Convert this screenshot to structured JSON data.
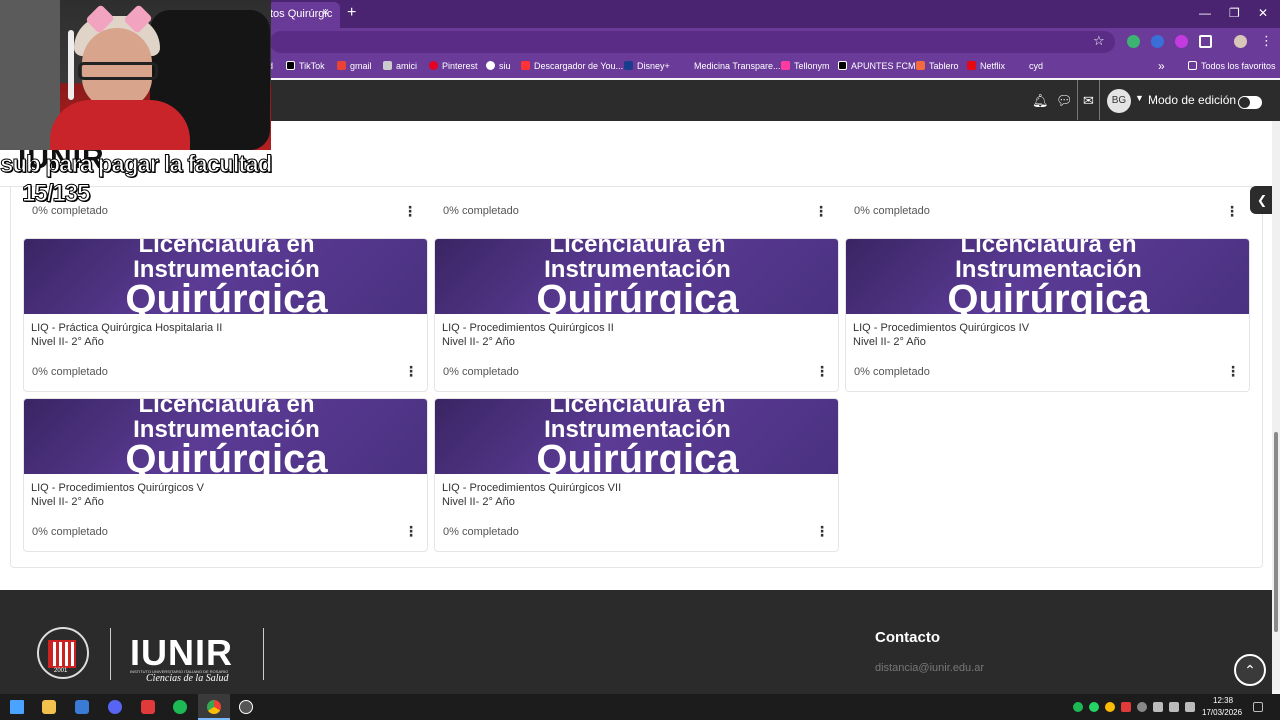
{
  "browser": {
    "tab_title": "tos Quirúrgic",
    "tab_close": "×",
    "new_tab": "+",
    "window_controls": [
      "—",
      "❐",
      "✕"
    ],
    "bookmarks": [
      {
        "label": "d",
        "icon": "bookmark-icon",
        "color": "#ffffff"
      },
      {
        "label": "TikTok",
        "icon": "tiktok-icon",
        "color": "#000000"
      },
      {
        "label": "gmail",
        "icon": "gmail-icon",
        "color": "#ea4335"
      },
      {
        "label": "amici",
        "icon": "amici-icon",
        "color": "#cccccc"
      },
      {
        "label": "Pinterest",
        "icon": "pinterest-icon",
        "color": "#e60023"
      },
      {
        "label": "siu",
        "icon": "siu-icon",
        "color": "#ffffff"
      },
      {
        "label": "Descargador de You...",
        "icon": "downloader-icon",
        "color": "#ff3333"
      },
      {
        "label": "Disney+",
        "icon": "disney-icon",
        "color": "#1a3c8c"
      },
      {
        "label": "Medicina Transpare...",
        "icon": "medicina-icon",
        "color": "#6b3b9a"
      },
      {
        "label": "Tellonym",
        "icon": "tellonym-icon",
        "color": "#ff3aa0"
      },
      {
        "label": "APUNTES FCM",
        "icon": "apuntes-icon",
        "color": "#000000"
      },
      {
        "label": "Tablero",
        "icon": "tablero-icon",
        "color": "#f26a3d"
      },
      {
        "label": "Netflix",
        "icon": "netflix-icon",
        "color": "#e50914"
      },
      {
        "label": "cyd",
        "icon": "cyd-icon",
        "color": "#6b3b9a"
      }
    ],
    "bookmarks_more": "»",
    "all_bookmarks": "Todos los favoritos"
  },
  "navbar": {
    "avatar_initials": "BG",
    "edit_mode_label": "Modo de edición"
  },
  "overlay": {
    "line1": "sub para pagar la facultad",
    "line2": "15/135"
  },
  "site_logo_partial": "IUNIR",
  "top_row_progress": [
    "0% completado",
    "0% completado",
    "0% completado"
  ],
  "courses": [
    {
      "banner_l1": "Licenciatura en",
      "banner_l2": "Instrumentación",
      "banner_l3": "Quirúrgica",
      "title": "LIQ - Práctica Quirúrgica Hospitalaria II",
      "level": "Nivel II- 2° Año",
      "progress": "0% completado"
    },
    {
      "banner_l1": "Licenciatura en",
      "banner_l2": "Instrumentación",
      "banner_l3": "Quirúrgica",
      "title": "LIQ - Procedimientos Quirúrgicos II",
      "level": "Nivel II- 2° Año",
      "progress": "0% completado"
    },
    {
      "banner_l1": "Licenciatura en",
      "banner_l2": "Instrumentación",
      "banner_l3": "Quirúrgica",
      "title": "LIQ - Procedimientos Quirúrgicos IV",
      "level": "Nivel II- 2° Año",
      "progress": "0% completado"
    },
    {
      "banner_l1": "Licenciatura en",
      "banner_l2": "Instrumentación",
      "banner_l3": "Quirúrgica",
      "title": "LIQ - Procedimientos Quirúrgicos V",
      "level": "Nivel II- 2° Año",
      "progress": "0% completado"
    },
    {
      "banner_l1": "Licenciatura en",
      "banner_l2": "Instrumentación",
      "banner_l3": "Quirúrgica",
      "title": "LIQ - Procedimientos Quirúrgicos VII",
      "level": "Nivel II- 2° Año",
      "progress": "0% completado"
    }
  ],
  "footer": {
    "brand": "IUNIR",
    "brand_subtitle": "INSTITUTO UNIVERSITARIO ITALIANO DE ROSARIO",
    "brand_tagline": "Ciencias de la Salud",
    "seal_year": "2001",
    "contact_title": "Contacto",
    "contact_email": "distancia@iunir.edu.ar"
  },
  "taskbar": {
    "time": "12:38",
    "date": "17/03/2026"
  },
  "colors": {
    "browser_accent": "#6b3b9a",
    "navbar": "#2c2c2c",
    "footer": "#2b2b2b",
    "banner": "#4a3180"
  }
}
